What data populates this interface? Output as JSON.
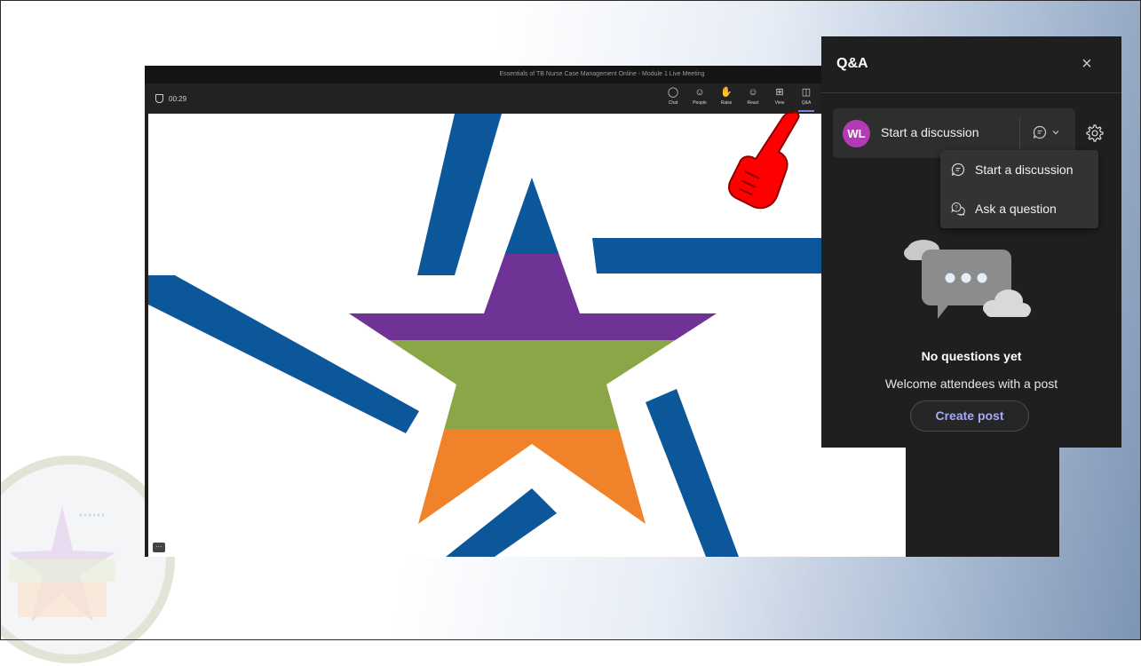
{
  "meeting": {
    "window_title": "Essentials of TB Nurse Case Management Online - Module 1 Live Meeting",
    "timer": "00:29",
    "toolbar": [
      {
        "label": "Chat",
        "icon": "chat-icon"
      },
      {
        "label": "People",
        "icon": "people-icon"
      },
      {
        "label": "Raise",
        "icon": "raise-hand-icon"
      },
      {
        "label": "React",
        "icon": "react-smiley-icon"
      },
      {
        "label": "View",
        "icon": "view-grid-icon"
      },
      {
        "label": "Q&A",
        "icon": "qa-icon",
        "active": true
      }
    ],
    "more_button": "···"
  },
  "qa_panel": {
    "title": "Q&A",
    "close_icon": "close-icon",
    "avatar_initials": "WL",
    "avatar_color": "#b33ab7",
    "composer_placeholder": "Start a discussion",
    "post_type_menu": [
      {
        "label": "Start a discussion",
        "icon": "discussion-icon"
      },
      {
        "label": "Ask a question",
        "icon": "question-icon"
      }
    ],
    "empty_state": {
      "title": "No questions yet",
      "subtitle": "Welcome attendees with a post",
      "button": "Create post"
    },
    "accent_color": "#a4aaf4"
  },
  "logo_colors": {
    "blue": "#0b579a",
    "purple": "#6e3394",
    "green": "#8ba646",
    "orange": "#f0832a"
  }
}
